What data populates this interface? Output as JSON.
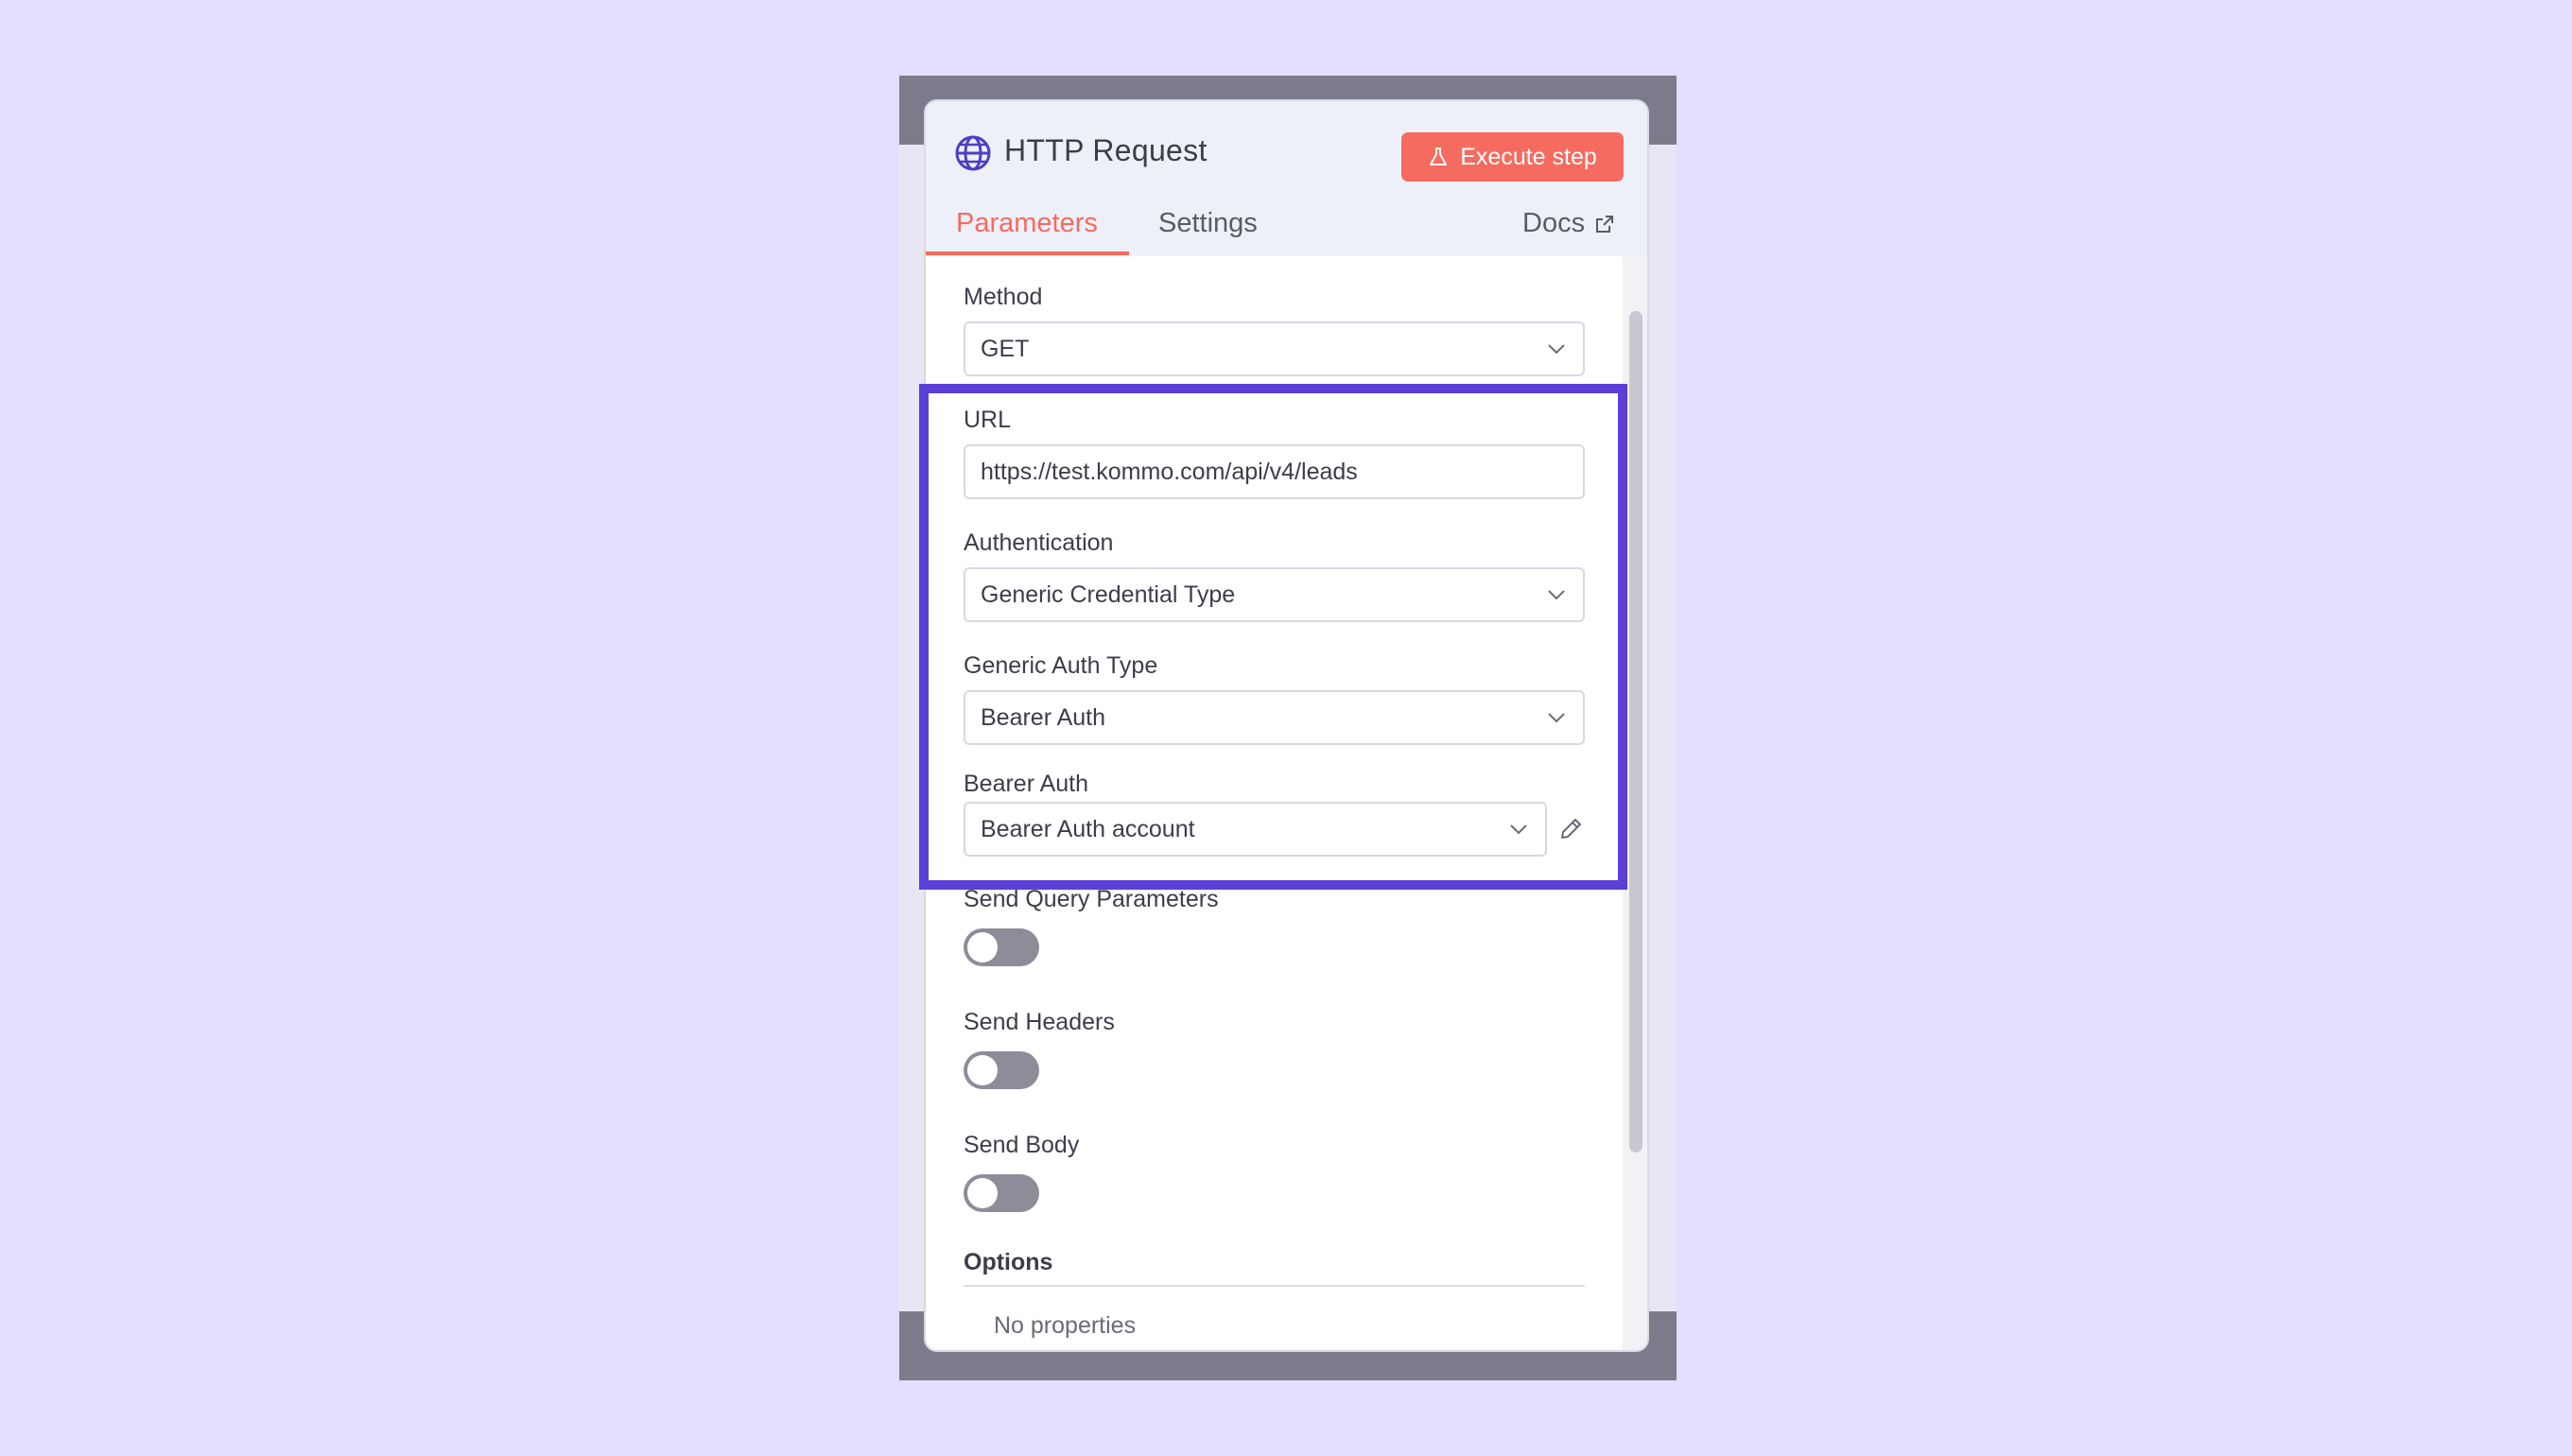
{
  "node": {
    "title": "HTTP Request",
    "icon": "globe-icon",
    "execute_label": "Execute step"
  },
  "tabs": {
    "parameters": "Parameters",
    "settings": "Settings",
    "docs": "Docs",
    "active": "Parameters"
  },
  "fields": {
    "method": {
      "label": "Method",
      "value": "GET"
    },
    "url": {
      "label": "URL",
      "value": "https://test.kommo.com/api/v4/leads"
    },
    "authentication": {
      "label": "Authentication",
      "value": "Generic Credential Type"
    },
    "generic_auth_type": {
      "label": "Generic Auth Type",
      "value": "Bearer Auth"
    },
    "bearer_auth": {
      "label": "Bearer Auth",
      "value": "Bearer Auth account"
    }
  },
  "toggles": {
    "query": {
      "label": "Send Query Parameters",
      "on": false
    },
    "headers": {
      "label": "Send Headers",
      "on": false
    },
    "body": {
      "label": "Send Body",
      "on": false
    }
  },
  "options": {
    "heading": "Options",
    "empty_text": "No properties"
  },
  "colors": {
    "accent": "#f56b60",
    "highlight": "#5b3fd6",
    "background": "#e3defe",
    "globe": "#4b3fc4"
  }
}
